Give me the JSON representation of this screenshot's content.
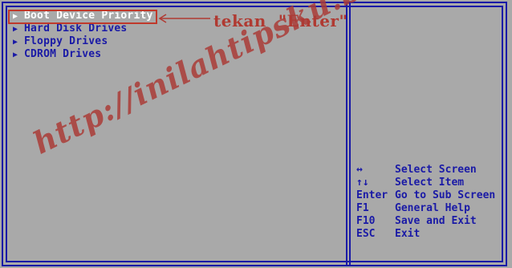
{
  "menu": {
    "items": [
      {
        "label": "Boot Device Priority",
        "selected": true
      },
      {
        "label": "Hard Disk Drives",
        "selected": false
      },
      {
        "label": "Floppy Drives",
        "selected": false
      },
      {
        "label": "CDROM Drives",
        "selected": false
      }
    ]
  },
  "annotation": {
    "text": "tekan  \"Enter\""
  },
  "help": {
    "items": [
      {
        "key": "↔",
        "action": "Select Screen"
      },
      {
        "key": "↑↓",
        "action": "Select Item"
      },
      {
        "key": "Enter",
        "action": "Go to Sub Screen"
      },
      {
        "key": "F1",
        "action": "General Help"
      },
      {
        "key": "F10",
        "action": "Save and Exit"
      },
      {
        "key": "ESC",
        "action": "Exit"
      }
    ]
  },
  "watermark": {
    "text": "http://inilahtipsku.blogspot.com/"
  },
  "colors": {
    "background": "#a9a9a9",
    "bios_blue": "#1a1aa6",
    "selected_text": "#ffffff",
    "annotation_red": "#b03a32"
  },
  "icons": {
    "menu_item": "triangle-right-icon",
    "annotation": "arrow-left-icon"
  }
}
